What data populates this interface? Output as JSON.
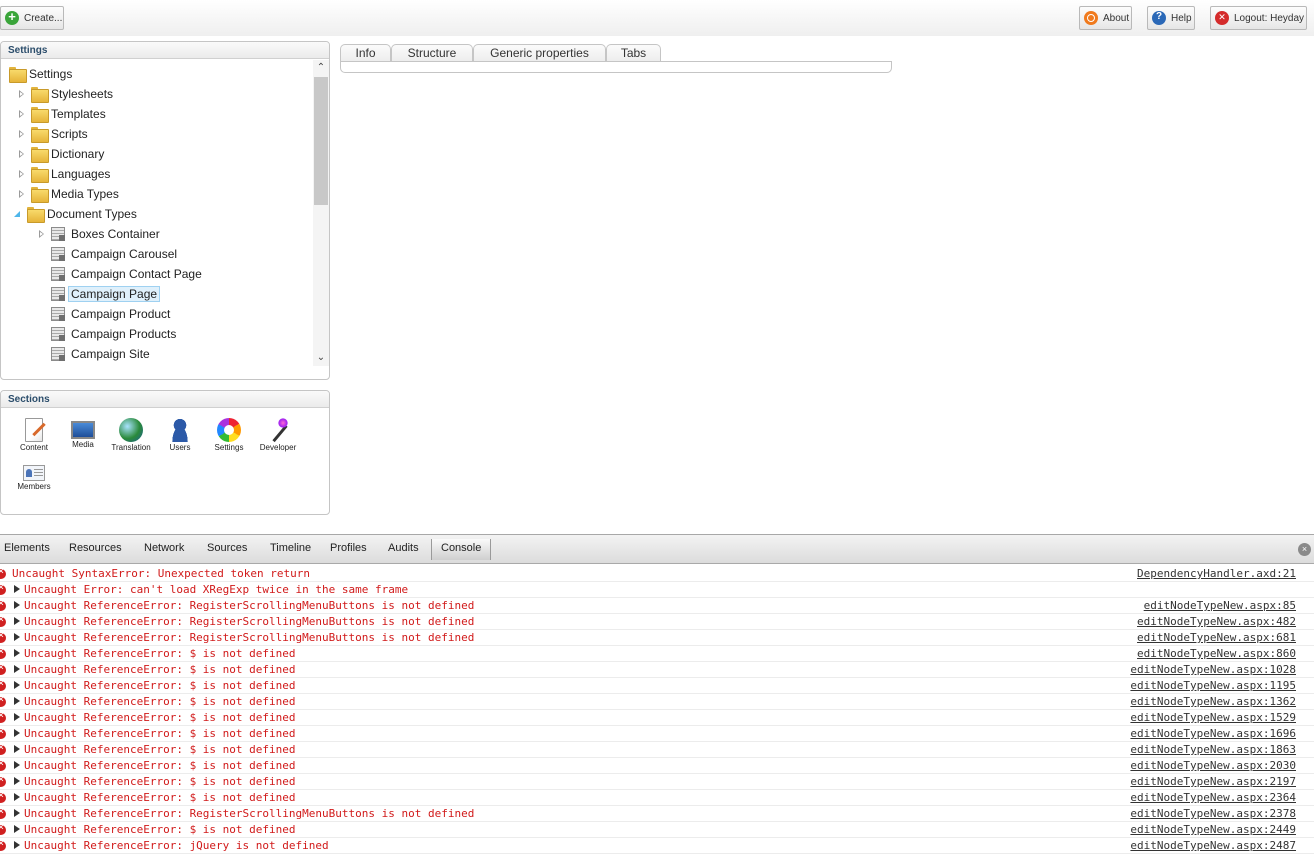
{
  "toolbar": {
    "create_label": "Create...",
    "about_label": "About",
    "help_label": "Help",
    "logout_label": "Logout: Heyday"
  },
  "settings_panel": {
    "title": "Settings",
    "tree": [
      {
        "label": "Settings",
        "icon": "folder-icon",
        "arrow": "none"
      },
      {
        "label": "Stylesheets",
        "icon": "folder-icon",
        "arrow": "closed"
      },
      {
        "label": "Templates",
        "icon": "folder-icon",
        "arrow": "closed"
      },
      {
        "label": "Scripts",
        "icon": "folder-icon",
        "arrow": "closed"
      },
      {
        "label": "Dictionary",
        "icon": "folder-icon",
        "arrow": "closed"
      },
      {
        "label": "Languages",
        "icon": "folder-icon",
        "arrow": "closed"
      },
      {
        "label": "Media Types",
        "icon": "folder-icon",
        "arrow": "closed"
      },
      {
        "label": "Document Types",
        "icon": "folder-icon",
        "arrow": "open"
      },
      {
        "label": "Boxes Container",
        "icon": "doctype-icon",
        "arrow": "closed"
      },
      {
        "label": "Campaign Carousel",
        "icon": "doctype-icon",
        "arrow": "none"
      },
      {
        "label": "Campaign Contact Page",
        "icon": "doctype-icon",
        "arrow": "none"
      },
      {
        "label": "Campaign Page",
        "icon": "doctype-icon",
        "arrow": "none",
        "selected": true
      },
      {
        "label": "Campaign Product",
        "icon": "doctype-icon",
        "arrow": "none"
      },
      {
        "label": "Campaign Products",
        "icon": "doctype-icon",
        "arrow": "none"
      },
      {
        "label": "Campaign Site",
        "icon": "doctype-icon",
        "arrow": "none"
      }
    ]
  },
  "sections_panel": {
    "title": "Sections",
    "items": [
      {
        "label": "Content",
        "icon": "content-icon"
      },
      {
        "label": "Media",
        "icon": "media-icon"
      },
      {
        "label": "Translation",
        "icon": "translation-icon"
      },
      {
        "label": "Users",
        "icon": "users-icon"
      },
      {
        "label": "Settings",
        "icon": "settings-icon"
      },
      {
        "label": "Developer",
        "icon": "developer-icon"
      },
      {
        "label": "Members",
        "icon": "members-icon"
      }
    ]
  },
  "tabs": [
    {
      "label": "Info"
    },
    {
      "label": "Structure"
    },
    {
      "label": "Generic properties"
    },
    {
      "label": "Tabs"
    }
  ],
  "devtools": {
    "tabs": [
      "Elements",
      "Resources",
      "Network",
      "Sources",
      "Timeline",
      "Profiles",
      "Audits",
      "Console"
    ],
    "active_tab": "Console",
    "console": [
      {
        "msg": "Uncaught SyntaxError: Unexpected token return",
        "src": "DependencyHandler.axd:21",
        "expand": false
      },
      {
        "msg": "Uncaught Error: can't load XRegExp twice in the same frame",
        "src": "",
        "expand": true
      },
      {
        "msg": "Uncaught ReferenceError: RegisterScrollingMenuButtons is not defined",
        "src": "editNodeTypeNew.aspx:85",
        "expand": true
      },
      {
        "msg": "Uncaught ReferenceError: RegisterScrollingMenuButtons is not defined",
        "src": "editNodeTypeNew.aspx:482",
        "expand": true
      },
      {
        "msg": "Uncaught ReferenceError: RegisterScrollingMenuButtons is not defined",
        "src": "editNodeTypeNew.aspx:681",
        "expand": true
      },
      {
        "msg": "Uncaught ReferenceError: $ is not defined",
        "src": "editNodeTypeNew.aspx:860",
        "expand": true
      },
      {
        "msg": "Uncaught ReferenceError: $ is not defined",
        "src": "editNodeTypeNew.aspx:1028",
        "expand": true
      },
      {
        "msg": "Uncaught ReferenceError: $ is not defined",
        "src": "editNodeTypeNew.aspx:1195",
        "expand": true
      },
      {
        "msg": "Uncaught ReferenceError: $ is not defined",
        "src": "editNodeTypeNew.aspx:1362",
        "expand": true
      },
      {
        "msg": "Uncaught ReferenceError: $ is not defined",
        "src": "editNodeTypeNew.aspx:1529",
        "expand": true
      },
      {
        "msg": "Uncaught ReferenceError: $ is not defined",
        "src": "editNodeTypeNew.aspx:1696",
        "expand": true
      },
      {
        "msg": "Uncaught ReferenceError: $ is not defined",
        "src": "editNodeTypeNew.aspx:1863",
        "expand": true
      },
      {
        "msg": "Uncaught ReferenceError: $ is not defined",
        "src": "editNodeTypeNew.aspx:2030",
        "expand": true
      },
      {
        "msg": "Uncaught ReferenceError: $ is not defined",
        "src": "editNodeTypeNew.aspx:2197",
        "expand": true
      },
      {
        "msg": "Uncaught ReferenceError: $ is not defined",
        "src": "editNodeTypeNew.aspx:2364",
        "expand": true
      },
      {
        "msg": "Uncaught ReferenceError: RegisterScrollingMenuButtons is not defined",
        "src": "editNodeTypeNew.aspx:2378",
        "expand": true
      },
      {
        "msg": "Uncaught ReferenceError: $ is not defined",
        "src": "editNodeTypeNew.aspx:2449",
        "expand": true
      },
      {
        "msg": "Uncaught ReferenceError: jQuery is not defined",
        "src": "editNodeTypeNew.aspx:2487",
        "expand": true
      }
    ]
  },
  "colors": {
    "error_text": "#d11a1a",
    "panel_title": "#2b4d6b",
    "selection": "#dff0fb"
  }
}
